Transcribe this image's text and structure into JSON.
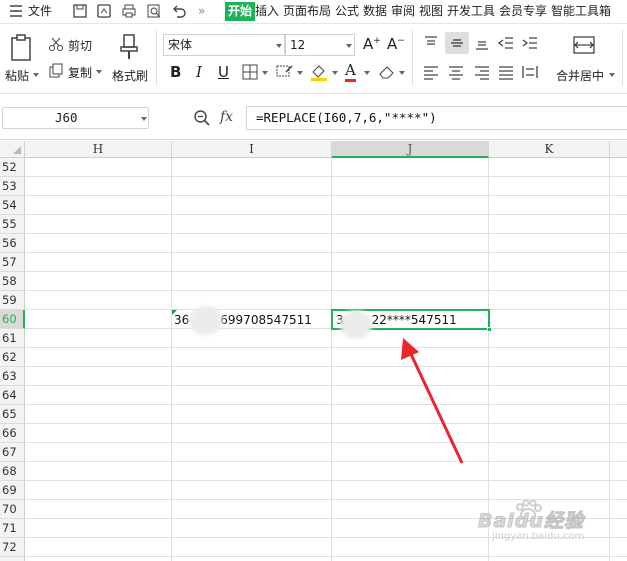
{
  "menubar": {
    "file_label": "文件",
    "tabs": [
      "开始",
      "插入",
      "页面布局",
      "公式",
      "数据",
      "审阅",
      "视图",
      "开发工具",
      "会员专享",
      "智能工具箱"
    ]
  },
  "ribbon": {
    "paste": "粘贴",
    "cut": "剪切",
    "copy": "复制",
    "format_painter": "格式刷",
    "font_name": "宋体",
    "font_size": "12",
    "merge_center": "合并居中"
  },
  "formula_bar": {
    "name_box": "J60",
    "fx_label": "fx",
    "formula": "=REPLACE(I60,7,6,\"****\")"
  },
  "grid": {
    "columns": [
      "H",
      "I",
      "J",
      "K"
    ],
    "active_column": "J",
    "rows": [
      "52",
      "53",
      "54",
      "55",
      "56",
      "57",
      "58",
      "59",
      "60",
      "61",
      "62",
      "63",
      "64",
      "65",
      "66",
      "67",
      "68",
      "69",
      "70",
      "71",
      "72"
    ],
    "active_row": "60",
    "cells": {
      "I60_prefix": "36",
      "I60_suffix": "699708547511",
      "J60_prefix": "3",
      "J60_suffix": "22****547511"
    }
  },
  "colors": {
    "accent": "#1eb35b",
    "arrow": "#e8262b"
  },
  "watermark": {
    "text": "Baidu经验",
    "url": "jingyan.baidu.com"
  }
}
